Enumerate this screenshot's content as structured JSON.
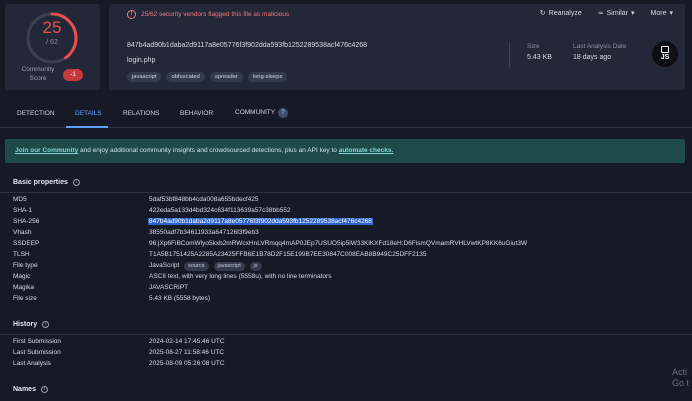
{
  "score": {
    "detections": "25",
    "total": "/ 62",
    "community_label": "Community Score",
    "community_score": "-1",
    "color": "#ee4d4d",
    "fraction": 0.4032
  },
  "alert": {
    "icon": "alert-circle-icon",
    "text": "25/62 security vendors flagged this file as malicious"
  },
  "actions": [
    {
      "label": "Reanalyze",
      "icon": "refresh-icon"
    },
    {
      "label": "Similar",
      "icon": "similar-icon"
    },
    {
      "label": "More",
      "icon": "chevron-down-icon"
    }
  ],
  "file": {
    "hash": "847b4ad90b1daba2d9117a8e05776f3f902dda593fb1252289538acf476c4268",
    "name": "login.php",
    "tags": [
      "javascript",
      "obfuscated",
      "spreader",
      "long-sleeps"
    ],
    "size_label": "Size",
    "size": "5.43 KB",
    "last_analysis_label": "Last Analysis Date",
    "last_analysis": "18 days ago",
    "type_icon": "JS"
  },
  "tabs": [
    {
      "label": "DETECTION",
      "active": false
    },
    {
      "label": "DETAILS",
      "active": true
    },
    {
      "label": "RELATIONS",
      "active": false
    },
    {
      "label": "BEHAVIOR",
      "active": false
    },
    {
      "label": "COMMUNITY",
      "active": false,
      "count": "?"
    }
  ],
  "banner": {
    "link1": "Join our Community",
    "text": " and enjoy additional community insights and crowdsourced detections, plus an API key to ",
    "link2": "automate checks."
  },
  "basic_properties": {
    "title": "Basic properties",
    "rows": [
      {
        "label": "MD5",
        "value": "5daf53bf848bb4cda008a655bdecf425"
      },
      {
        "label": "SHA-1",
        "value": "422eda5a133d4bd324c634f113639a57c38bb552"
      },
      {
        "label": "SHA-256",
        "value": "847b4ad90b1daba2d9117a8e05776f3f902dda593fb1252289538acf476c4268"
      },
      {
        "label": "Vhash",
        "value": "38550adf7b34611933a647126f3f9eb3"
      },
      {
        "label": "SSDEEP",
        "value": "96:jXp6FiBComWlyo5kxb2mRWcxHnLVRmqq4mAP0JEp7USUO5ip5lW33KlKXFd18eH:D6FismQVmamRVHLVwtKP8KK6uGiut3W"
      },
      {
        "label": "TLSH",
        "value": "T1A5B1751425A2285A23425FFB6E1B78D2F15E199B7EE30847C008EAB8B949C25DFF2135"
      },
      {
        "label": "File type",
        "value": "JavaScript",
        "chips": [
          "source",
          "javascript",
          "js"
        ]
      },
      {
        "label": "Magic",
        "value": "ASCII text, with very long lines (5558u), with no line terminators"
      },
      {
        "label": "Magika",
        "value": "JAVASCRIPT"
      },
      {
        "label": "File size",
        "value": "5.43 KB (5558 bytes)"
      }
    ]
  },
  "history": {
    "title": "History",
    "rows": [
      {
        "label": "First Submission",
        "value": "2024-02-14 17:45:46 UTC"
      },
      {
        "label": "Last Submission",
        "value": "2025-08-27 11:58:46 UTC"
      },
      {
        "label": "Last Analysis",
        "value": "2025-08-09 05:26:08 UTC"
      }
    ]
  },
  "names": {
    "title": "Names"
  },
  "watermark": {
    "line1": "Acti",
    "line2": "Go t"
  }
}
